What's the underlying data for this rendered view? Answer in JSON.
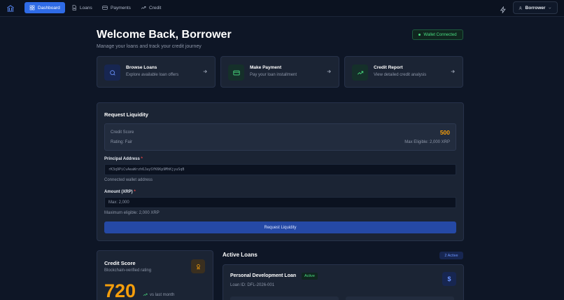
{
  "nav": {
    "items": [
      {
        "label": "Dashboard",
        "active": true
      },
      {
        "label": "Loans",
        "active": false
      },
      {
        "label": "Payments",
        "active": false
      },
      {
        "label": "Credit",
        "active": false
      }
    ],
    "user_label": "Borrower"
  },
  "header": {
    "title": "Welcome Back, Borrower",
    "subtitle": "Manage your loans and track your credit journey",
    "wallet_status": "Wallet Connected"
  },
  "quick_actions": [
    {
      "title": "Browse Loans",
      "subtitle": "Explore available loan offers",
      "icon": "search-icon",
      "color": "#3b82f6"
    },
    {
      "title": "Make Payment",
      "subtitle": "Pay your loan installment",
      "icon": "card-icon",
      "color": "#22c55e"
    },
    {
      "title": "Credit Report",
      "subtitle": "View detailed credit analysis",
      "icon": "trend-up-icon",
      "color": "#22c55e"
    }
  ],
  "request": {
    "title": "Request Liquidity",
    "score_label": "Credit Score",
    "score_value": "500",
    "rating": "Rating: Fair",
    "max_eligible": "Max Eligible: 2,000 XRP",
    "principal_label": "Principal Address",
    "principal_value": "rK3q9PiCvAeaWrzh6JaySYK6Kp9MhKjyuSqB",
    "principal_hint": "Connected wallet address",
    "amount_label": "Amount (XRP)",
    "amount_placeholder": "Max: 2,000",
    "amount_hint": "Maximum eligible: 2,000 XRP",
    "submit_label": "Request Liquidity"
  },
  "credit_card": {
    "title": "Credit Score",
    "subtitle": "Blockchain-verified rating",
    "score": "720",
    "trend": "vs last month"
  },
  "active_loans": {
    "title": "Active Loans",
    "badge": "2 Active",
    "loan": {
      "name": "Personal Development Loan",
      "status": "Active",
      "id": "Loan ID: DFL-2026-001"
    }
  }
}
